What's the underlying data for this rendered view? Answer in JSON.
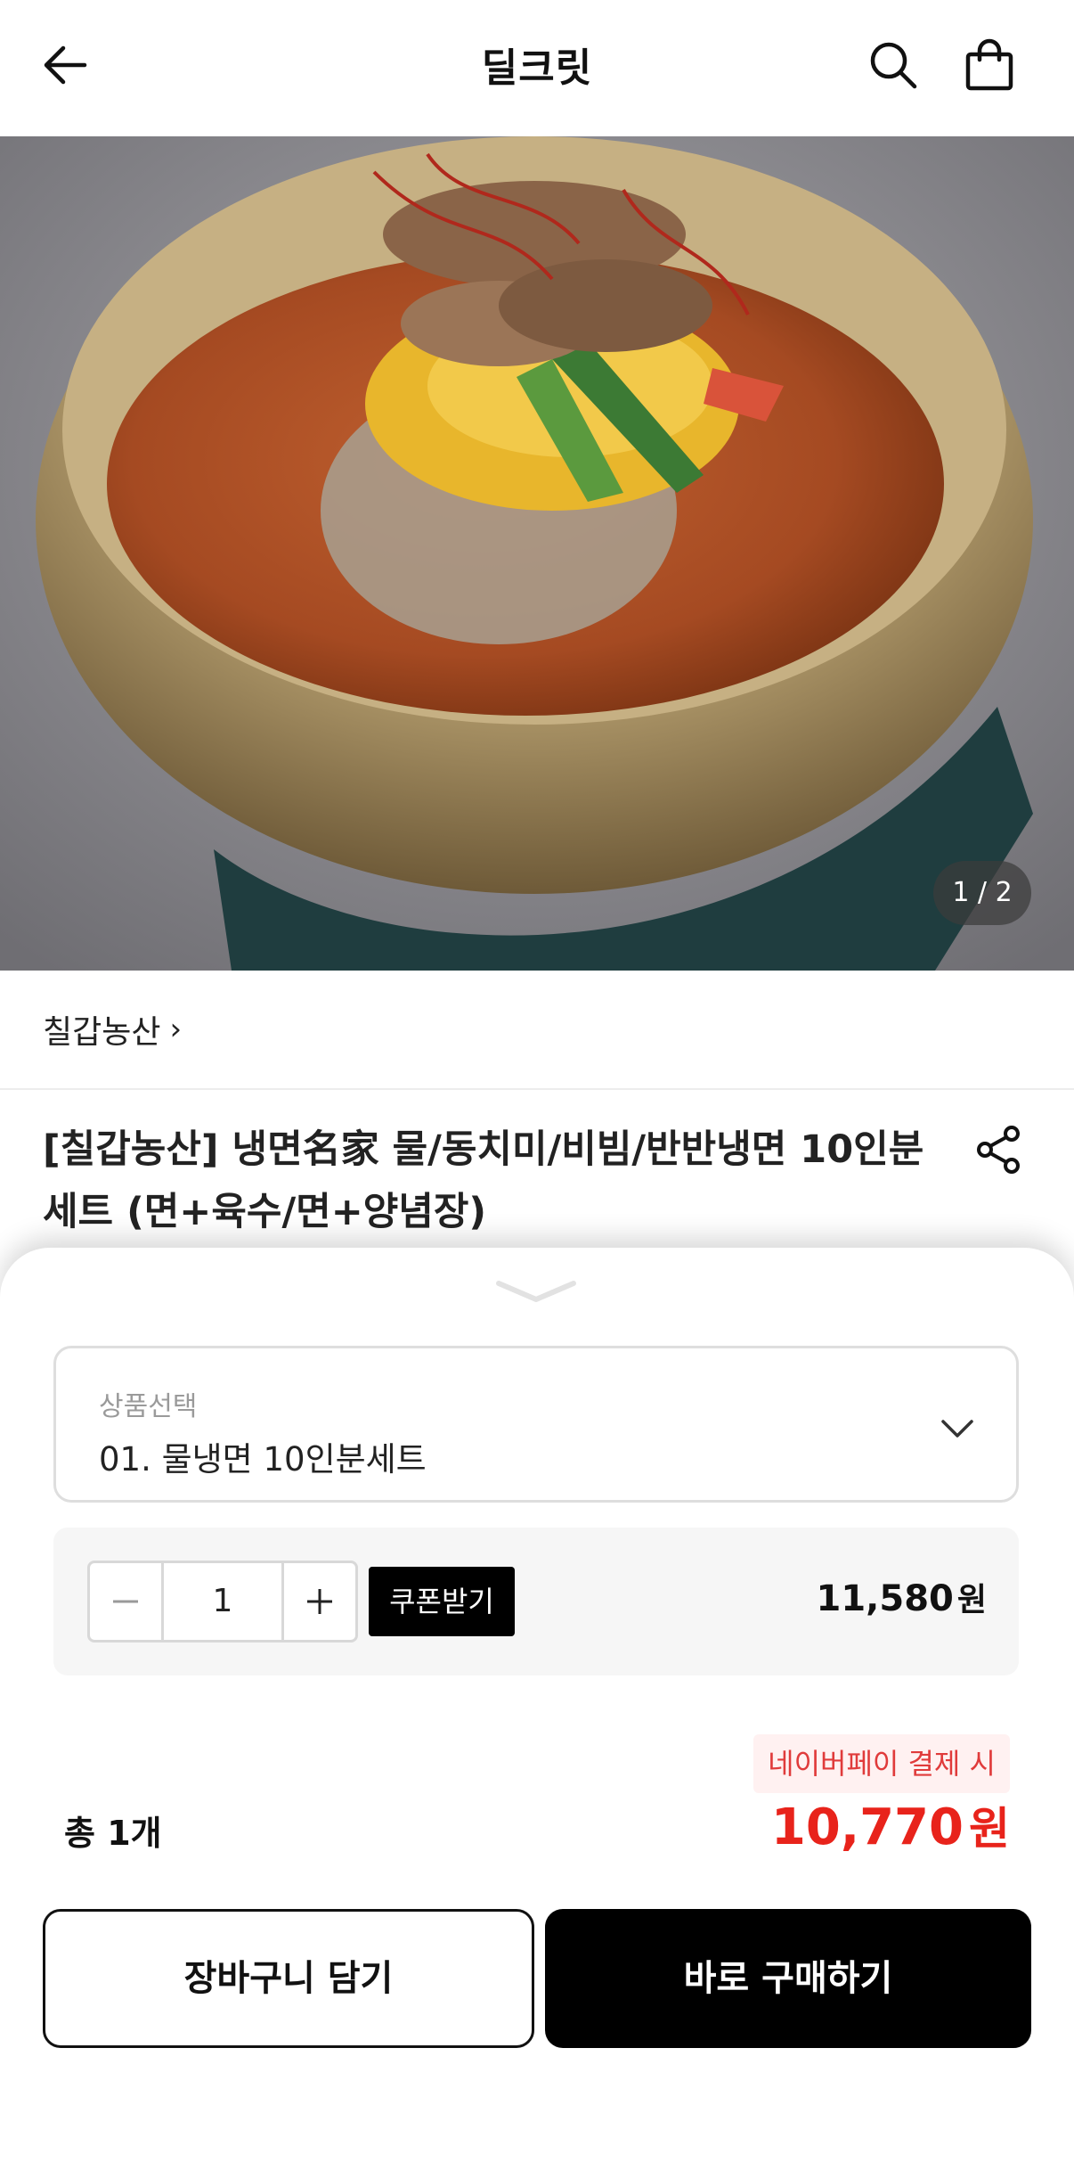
{
  "header": {
    "title": "딜크릿",
    "back_icon": "arrow-left-icon",
    "search_icon": "search-icon",
    "cart_icon": "shopping-bag-icon"
  },
  "gallery": {
    "counter": "1 / 2",
    "current": 1,
    "total": 2
  },
  "product": {
    "brand": "칠갑농산",
    "brand_chevron": "›",
    "title": "[칠갑농산] 냉면名家 물/동치미/비빔/반반냉면 10인분 세트 (면+육수/면+양념장)",
    "share_icon": "share-icon"
  },
  "purchase_sheet": {
    "option": {
      "label": "상품선택",
      "selected": "01. 물냉면 10인분세트"
    },
    "quantity": {
      "value": "1",
      "coupon_label": "쿠폰받기",
      "line_price": "11,580",
      "currency": "원"
    },
    "npay_note": "네이버페이 결제 시",
    "total_count": "총 1개",
    "total_price": "10,770",
    "total_currency": "원",
    "cart_button": "장바구니 담기",
    "buy_button": "바로 구매하기"
  },
  "colors": {
    "accent_red": "#e8231b",
    "primary_black": "#000000",
    "npay_badge_bg": "#fff1f1"
  }
}
